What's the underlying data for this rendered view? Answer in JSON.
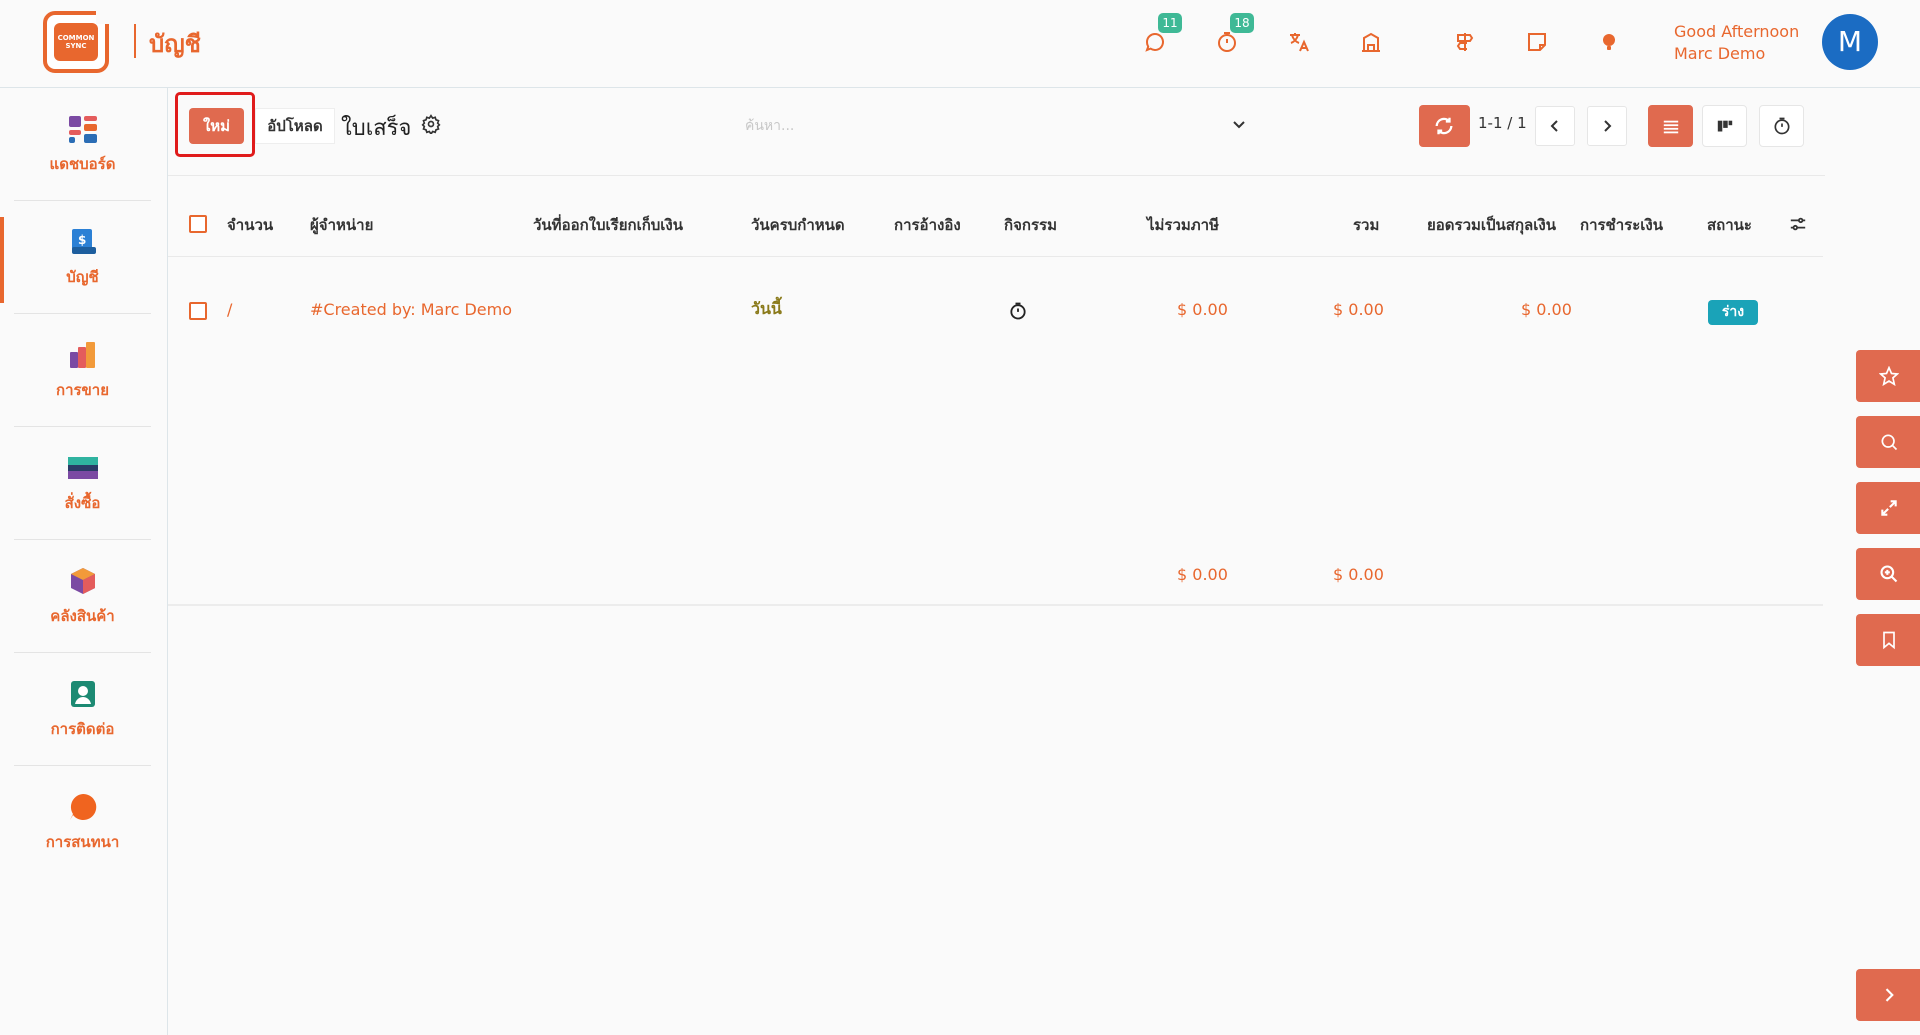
{
  "app": {
    "logo_text": "COMMON SYNC",
    "title": "บัญชี"
  },
  "topbar": {
    "messages_badge": "11",
    "activities_badge": "18",
    "greeting_line1": "Good Afternoon",
    "greeting_line2": "Marc Demo",
    "avatar_initial": "M"
  },
  "sidebar": {
    "items": [
      {
        "label": "แดชบอร์ด",
        "icon": "dashboard-icon"
      },
      {
        "label": "บัญชี",
        "icon": "accounting-icon"
      },
      {
        "label": "การขาย",
        "icon": "sales-icon"
      },
      {
        "label": "สั่งซื้อ",
        "icon": "purchase-icon"
      },
      {
        "label": "คลังสินค้า",
        "icon": "inventory-icon"
      },
      {
        "label": "การติดต่อ",
        "icon": "contacts-icon"
      },
      {
        "label": "การสนทนา",
        "icon": "discuss-icon"
      }
    ]
  },
  "controls": {
    "new_label": "ใหม่",
    "upload_label": "อัปโหลด",
    "heading": "ใบเสร็จ",
    "search_placeholder": "ค้นหา...",
    "pager": "1-1 / 1"
  },
  "table": {
    "headers": [
      "จำนวน",
      "ผู้จำหน่าย",
      "วันที่ออกใบเรียกเก็บเงิน",
      "วันครบกำหนด",
      "การอ้างอิง",
      "กิจกรรม",
      "ไม่รวมภาษี",
      "รวม",
      "ยอดรวมเป็นสกุลเงิน",
      "การชำระเงิน",
      "สถานะ"
    ],
    "rows": [
      {
        "number": "/",
        "vendor": "#Created by: Marc Demo",
        "invoice_date": "",
        "due_date": "วันนี้",
        "reference": "",
        "untaxed": "$ 0.00",
        "total": "$ 0.00",
        "total_currency": "$ 0.00",
        "payment": "",
        "status": "ร่าง"
      }
    ],
    "footer": {
      "untaxed": "$ 0.00",
      "total": "$ 0.00"
    }
  },
  "colors": {
    "accent": "#e8672e",
    "button": "#e06a4f",
    "status_draft": "#1aa3b8",
    "badge": "#3fb996",
    "avatar": "#1b6cc3"
  }
}
